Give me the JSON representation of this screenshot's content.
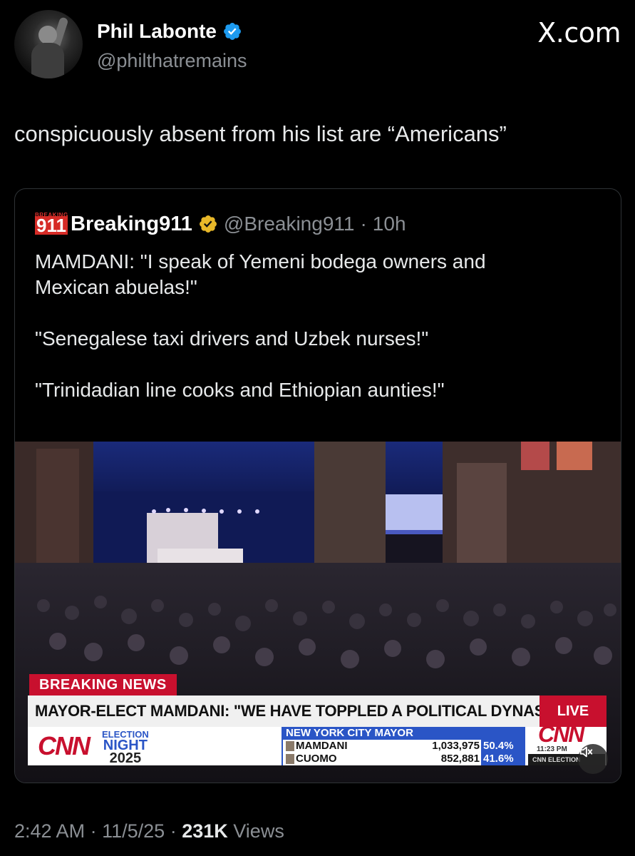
{
  "author": {
    "display_name": "Phil Labonte",
    "handle": "@philthatremains"
  },
  "brand": {
    "site_label": "X.com"
  },
  "tweet": {
    "text": "conspicuously absent from his list are “Americans”",
    "time": "2:42 AM",
    "date": "11/5/25",
    "views_count": "231K",
    "views_label": "Views",
    "separator": "·"
  },
  "quoted": {
    "logo_small": "BREAKING",
    "logo_big": "911",
    "display_name": "Breaking911",
    "handle": "@Breaking911",
    "age": "10h",
    "separator": "·",
    "paragraphs": [
      "MAMDANI: \"I speak of Yemeni bodega owners and",
      "Mexican abuelas!\"",
      "\"Senegalese taxi drivers and Uzbek nurses!\"",
      "\"Trinidadian line cooks and Ethiopian aunties!\""
    ]
  },
  "video": {
    "breaking_tag": "BREAKING NEWS",
    "headline": "MAYOR-ELECT MAMDANI: \"WE HAVE TOPPLED A POLITICAL DYNASTY\"",
    "live": "LIVE",
    "network": "CNN",
    "election_label": "ELECTION",
    "night_label": "NIGHT",
    "year": "2025",
    "race_title": "NEW YORK CITY MAYOR",
    "candidates": [
      {
        "name": "MAMDANI",
        "votes": "1,033,975",
        "pct": "50.4%"
      },
      {
        "name": "CUOMO",
        "votes": "852,881",
        "pct": "41.6%"
      }
    ],
    "clock": "11:23 PM",
    "footer_label": "CNN ELECTION",
    "mute_icon": "speaker-muted-icon"
  },
  "colors": {
    "background": "#000000",
    "verified_blue": "#1d9bf0",
    "verified_gold": "#e8b829",
    "cnn_red": "#c8102e",
    "cnn_blue": "#2a55c6"
  }
}
